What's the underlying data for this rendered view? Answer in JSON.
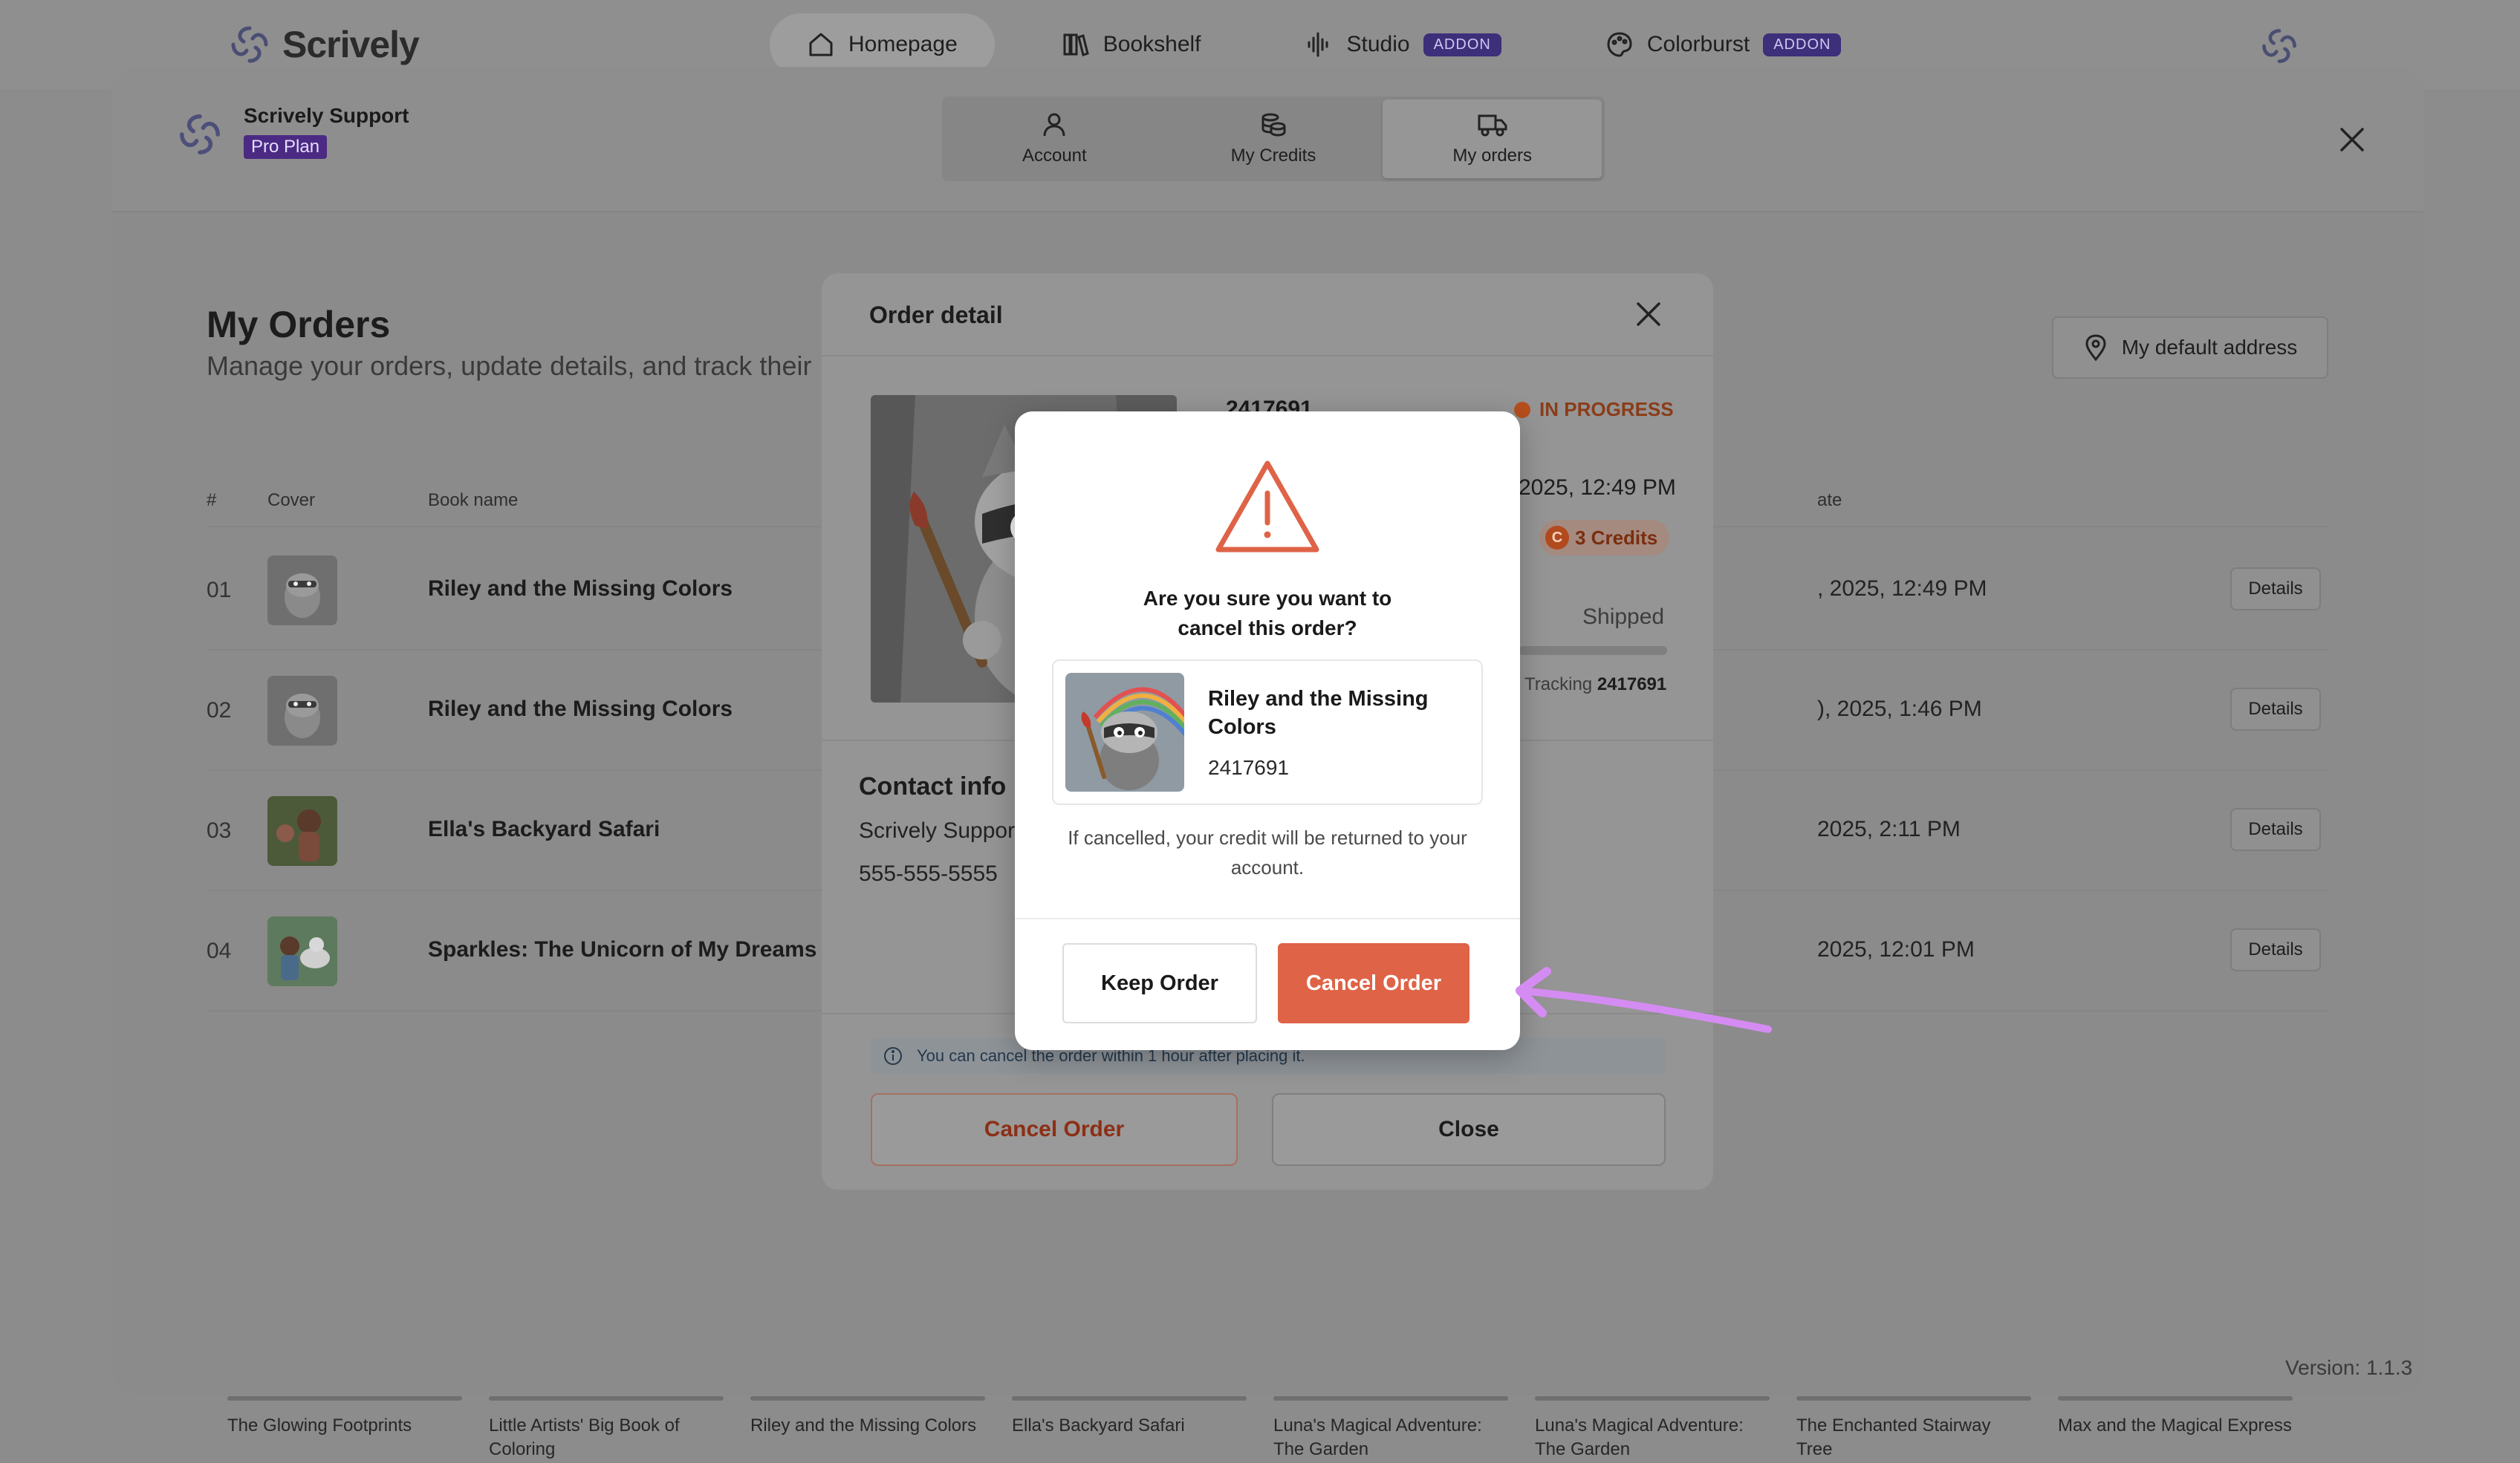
{
  "app": {
    "brand": "Scrively",
    "nav": [
      {
        "label": "Homepage",
        "icon": "home-icon",
        "addon": ""
      },
      {
        "label": "Bookshelf",
        "icon": "bookshelf-icon",
        "addon": ""
      },
      {
        "label": "Studio",
        "icon": "audio-wave-icon",
        "addon": "ADDON"
      },
      {
        "label": "Colorburst",
        "icon": "palette-icon",
        "addon": "ADDON"
      }
    ]
  },
  "profile": {
    "name": "Scrively Support",
    "plan": "Pro Plan",
    "tabs": [
      {
        "label": "Account",
        "icon": "user-icon"
      },
      {
        "label": "My Credits",
        "icon": "coins-icon"
      },
      {
        "label": "My orders",
        "icon": "truck-icon"
      }
    ]
  },
  "orders": {
    "title": "My Orders",
    "subtitle": "Manage your orders, update details, and track their",
    "address_button": "My default address",
    "columns": {
      "num": "#",
      "cover": "Cover",
      "book": "Book name",
      "date": "ate"
    },
    "rows": [
      {
        "num": "01",
        "book": "Riley and the Missing Colors",
        "date": ", 2025, 12:49 PM",
        "details": "Details"
      },
      {
        "num": "02",
        "book": "Riley and the Missing Colors",
        "date": "), 2025, 1:46 PM",
        "details": "Details"
      },
      {
        "num": "03",
        "book": "Ella's Backyard Safari",
        "date": "2025, 2:11 PM",
        "details": "Details"
      },
      {
        "num": "04",
        "book": "Sparkles: The Unicorn of My Dreams",
        "date": "2025, 12:01 PM",
        "details": "Details"
      }
    ]
  },
  "version": "Version: 1.1.3",
  "shelf": [
    "The Glowing Footprints",
    "Little Artists' Big Book of Coloring",
    "Riley and the Missing Colors",
    "Ella's Backyard Safari",
    "Luna's Magical Adventure: The Garden",
    "Luna's Magical Adventure: The Garden",
    "The Enchanted Stairway Tree",
    "Max and the Magical Express"
  ],
  "order_detail": {
    "title": "Order detail",
    "order_id": "2417691",
    "status": "IN PROGRESS",
    "date": "2025, 12:49 PM",
    "credits": "3 Credits",
    "shipping_status": "Shipped",
    "tracking_label": "Tracking",
    "tracking_number": "2417691",
    "contact_title": "Contact info",
    "contact_name": "Scrively Support",
    "contact_phone": "555-555-5555",
    "info": "You can cancel the order within 1 hour after placing it.",
    "cancel_label": "Cancel Order",
    "close_label": "Close"
  },
  "confirm": {
    "question": "Are you sure you want to cancel this order?",
    "book_title": "Riley and the Missing Colors",
    "order_id": "2417691",
    "note": "If cancelled, your credit will be returned to your account.",
    "keep_label": "Keep Order",
    "cancel_label": "Cancel Order"
  },
  "colors": {
    "accent_danger": "#df6347",
    "annotation": "#d58cf2",
    "plan_badge": "#4b2a83"
  }
}
